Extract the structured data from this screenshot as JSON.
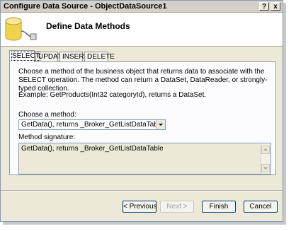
{
  "window": {
    "title": "Configure Data Source - ObjectDataSource1",
    "help_glyph": "?",
    "close_glyph": "x"
  },
  "header": {
    "icon": "database-icon",
    "title": "Define Data Methods"
  },
  "tabs": [
    {
      "label": "SELECT",
      "active": true
    },
    {
      "label": "UPDATE",
      "active": false
    },
    {
      "label": "INSERT",
      "active": false
    },
    {
      "label": "DELETE",
      "active": false
    }
  ],
  "panel": {
    "description": "Choose a method of the business object that returns data to associate with the SELECT operation. The method can return a DataSet, DataReader, or strongly-typed collection.",
    "example": "Example: GetProducts(Int32 categoryId), returns a DataSet.",
    "method_label": "Choose a method:",
    "method_value": "GetData(), returns _Broker_GetListDataTable",
    "signature_label": "Method signature:",
    "signature_value": "GetData(), returns _Broker_GetListDataTable"
  },
  "buttons": {
    "previous": "< Previous",
    "next": "Next >",
    "finish": "Finish",
    "cancel": "Cancel"
  },
  "colors": {
    "dialog_bg": "#ece9d8",
    "button_border": "#003c74",
    "disabled_text": "#a0a0a0"
  }
}
